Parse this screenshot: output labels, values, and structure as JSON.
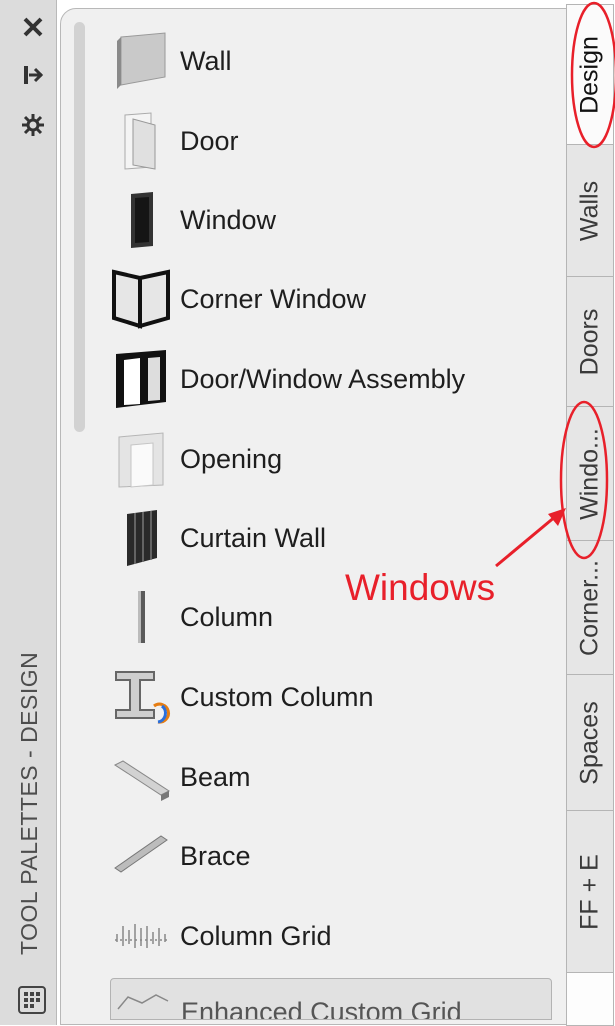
{
  "palette": {
    "title": "TOOL PALETTES - DESIGN",
    "tools": [
      {
        "label": "Wall",
        "icon": "wall-icon"
      },
      {
        "label": "Door",
        "icon": "door-icon"
      },
      {
        "label": "Window",
        "icon": "window-icon"
      },
      {
        "label": "Corner Window",
        "icon": "corner-window-icon"
      },
      {
        "label": "Door/Window Assembly",
        "icon": "door-window-assembly-icon"
      },
      {
        "label": "Opening",
        "icon": "opening-icon"
      },
      {
        "label": "Curtain Wall",
        "icon": "curtain-wall-icon"
      },
      {
        "label": "Column",
        "icon": "column-icon"
      },
      {
        "label": "Custom Column",
        "icon": "custom-column-icon"
      },
      {
        "label": "Beam",
        "icon": "beam-icon"
      },
      {
        "label": "Brace",
        "icon": "brace-icon"
      },
      {
        "label": "Column Grid",
        "icon": "column-grid-icon"
      }
    ],
    "partial_tool": {
      "label": "Enhanced Custom Grid",
      "icon": "enhanced-custom-grid-icon"
    }
  },
  "tabs": [
    {
      "label": "Design",
      "active": true
    },
    {
      "label": "Walls",
      "active": false
    },
    {
      "label": "Doors",
      "active": false
    },
    {
      "label": "Windo...",
      "active": false
    },
    {
      "label": "Corner...",
      "active": false
    },
    {
      "label": "Spaces",
      "active": false
    },
    {
      "label": "FF + E",
      "active": false
    }
  ],
  "annotation": {
    "text": "Windows",
    "color": "#e8202a"
  },
  "colors": {
    "panel_bg": "#f0f0f0",
    "strip_bg": "#dcdcdc",
    "annotation": "#e8202a"
  }
}
